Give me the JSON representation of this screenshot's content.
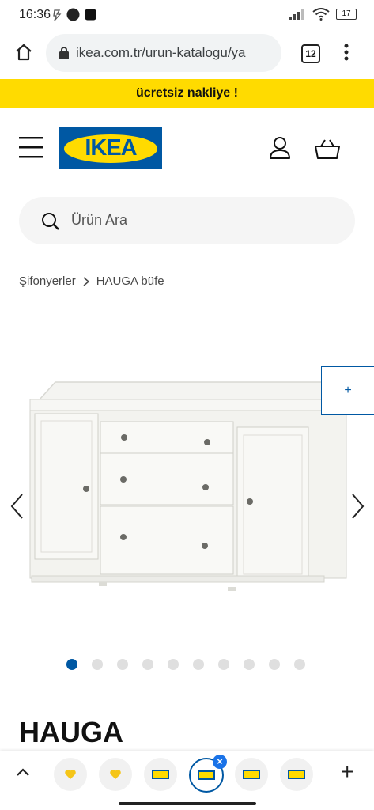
{
  "status_bar": {
    "time": "16:36",
    "battery": "17"
  },
  "browser": {
    "url": "ikea.com.tr/urun-katalogu/ya",
    "tab_count": "12"
  },
  "promo": {
    "text": "ücretsiz nakliye !"
  },
  "header": {
    "logo_text": "IKEA"
  },
  "search": {
    "placeholder": "Ürün Ara"
  },
  "breadcrumb": {
    "parent": "Şifonyerler",
    "current": "HAUGA büfe"
  },
  "gallery": {
    "total_images": 10,
    "active_index": 0,
    "plus_label": "+"
  },
  "product": {
    "name": "HAUGA"
  },
  "tab_tray": {
    "add_label": "+"
  },
  "colors": {
    "ikea_blue": "#0058a3",
    "ikea_yellow": "#ffdb00",
    "chrome_blue": "#1a73e8"
  }
}
